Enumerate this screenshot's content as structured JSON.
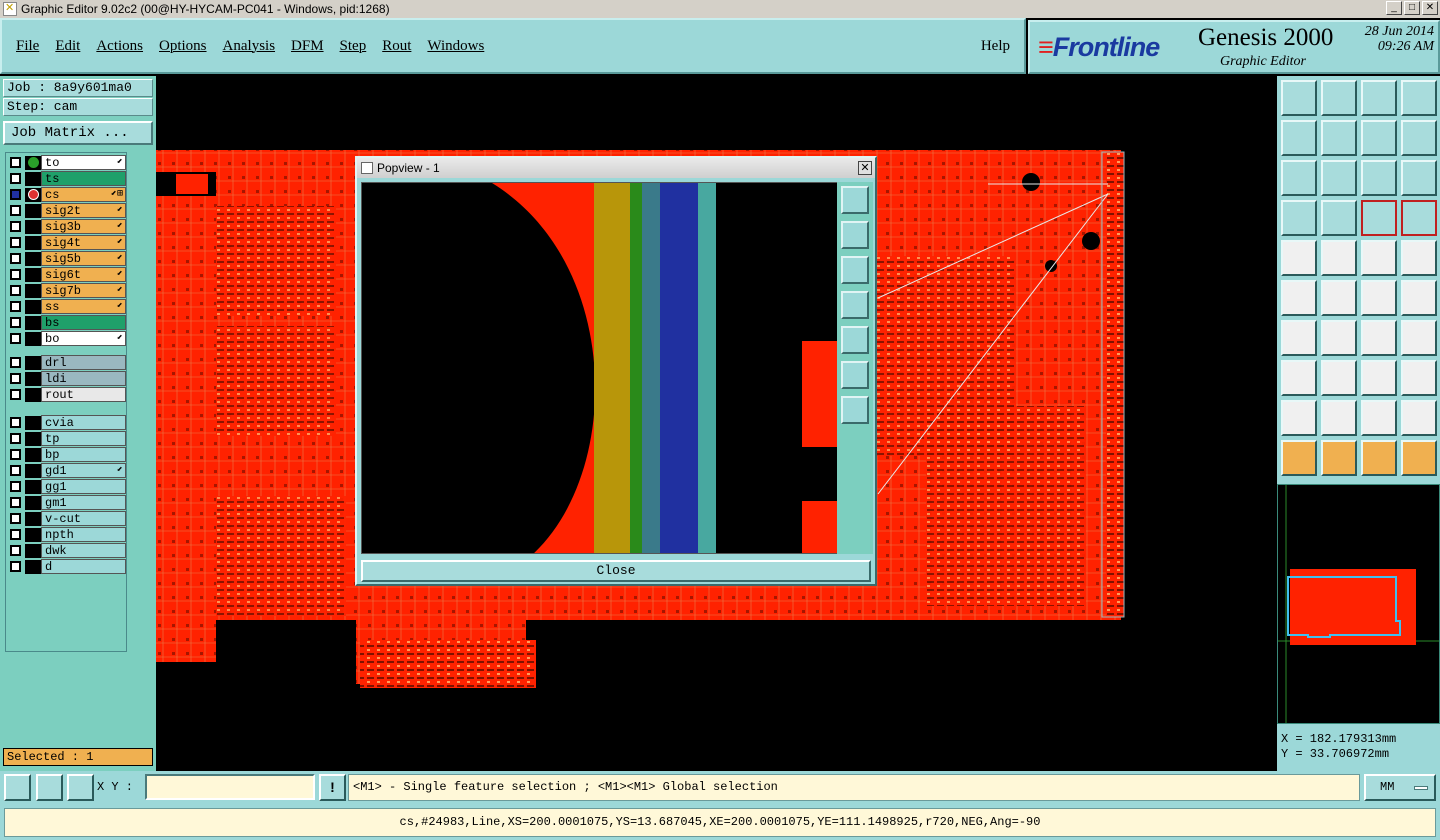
{
  "window": {
    "title": "Graphic Editor 9.02c2 (00@HY-HYCAM-PC041 - Windows, pid:1268)"
  },
  "menu": {
    "items": [
      "File",
      "Edit",
      "Actions",
      "Options",
      "Analysis",
      "DFM",
      "Step",
      "Rout",
      "Windows"
    ],
    "help": "Help"
  },
  "brand": {
    "logo": "Frontline",
    "product": "Genesis 2000",
    "subtitle": "Graphic Editor",
    "date": "28 Jun 2014",
    "time": "09:26 AM"
  },
  "job": {
    "job_label": "Job : 8a9y601ma0",
    "step_label": "Step: cam",
    "matrix_button": "Job Matrix ..."
  },
  "layers": [
    {
      "name": "to",
      "color": "#ffffff",
      "indicator": "green",
      "tag": "⬋"
    },
    {
      "name": "ts",
      "color": "#1fa06a",
      "indicator": "",
      "tag": ""
    },
    {
      "name": "cs",
      "color": "#f0b050",
      "indicator": "red",
      "tag": "⬋⊞"
    },
    {
      "name": "sig2t",
      "color": "#f0b050",
      "indicator": "",
      "tag": "⬋"
    },
    {
      "name": "sig3b",
      "color": "#f0b050",
      "indicator": "",
      "tag": "⬋"
    },
    {
      "name": "sig4t",
      "color": "#f0b050",
      "indicator": "",
      "tag": "⬋"
    },
    {
      "name": "sig5b",
      "color": "#f0b050",
      "indicator": "",
      "tag": "⬋"
    },
    {
      "name": "sig6t",
      "color": "#f0b050",
      "indicator": "",
      "tag": "⬋"
    },
    {
      "name": "sig7b",
      "color": "#f0b050",
      "indicator": "",
      "tag": "⬋"
    },
    {
      "name": "ss",
      "color": "#f0b050",
      "indicator": "",
      "tag": "⬋"
    },
    {
      "name": "bs",
      "color": "#1fa06a",
      "indicator": "",
      "tag": ""
    },
    {
      "name": "bo",
      "color": "#ffffff",
      "indicator": "",
      "tag": "⬋"
    },
    {
      "name": "drl",
      "color": "#9ab8c0",
      "indicator": "",
      "tag": ""
    },
    {
      "name": "ldi",
      "color": "#9ab8c0",
      "indicator": "",
      "tag": ""
    },
    {
      "name": "rout",
      "color": "#e8e8e8",
      "indicator": "",
      "tag": ""
    },
    {
      "name": "cvia",
      "color": "#9cd8d8",
      "indicator": "",
      "tag": ""
    },
    {
      "name": "tp",
      "color": "#9cd8d8",
      "indicator": "",
      "tag": ""
    },
    {
      "name": "bp",
      "color": "#9cd8d8",
      "indicator": "",
      "tag": ""
    },
    {
      "name": "gd1",
      "color": "#9cd8d8",
      "indicator": "",
      "tag": "⬋"
    },
    {
      "name": "gg1",
      "color": "#9cd8d8",
      "indicator": "",
      "tag": ""
    },
    {
      "name": "gm1",
      "color": "#9cd8d8",
      "indicator": "",
      "tag": ""
    },
    {
      "name": "v-cut",
      "color": "#9cd8d8",
      "indicator": "",
      "tag": ""
    },
    {
      "name": "npth",
      "color": "#9cd8d8",
      "indicator": "",
      "tag": ""
    },
    {
      "name": "dwk",
      "color": "#9cd8d8",
      "indicator": "",
      "tag": ""
    },
    {
      "name": "d",
      "color": "#9cd8d8",
      "indicator": "",
      "tag": ""
    }
  ],
  "selected": "Selected : 1",
  "popview": {
    "title": "Popview - 1",
    "close": "Close"
  },
  "coords": {
    "x": "X = 182.179313mm",
    "y": "Y =  33.706972mm"
  },
  "cmd": {
    "xy_label": "X Y :",
    "xy_value": "",
    "message": "<M1> - Single feature selection ; <M1><M1> Global selection",
    "units": "MM"
  },
  "status": "cs,#24983,Line,XS=200.0001075,YS=13.687045,XE=200.0001075,YE=111.1498925,r720,NEG,Ang=-90",
  "colors": {
    "panel": "#9cd8d8",
    "copper": "#ff2200",
    "board_outline": "#e02020"
  }
}
